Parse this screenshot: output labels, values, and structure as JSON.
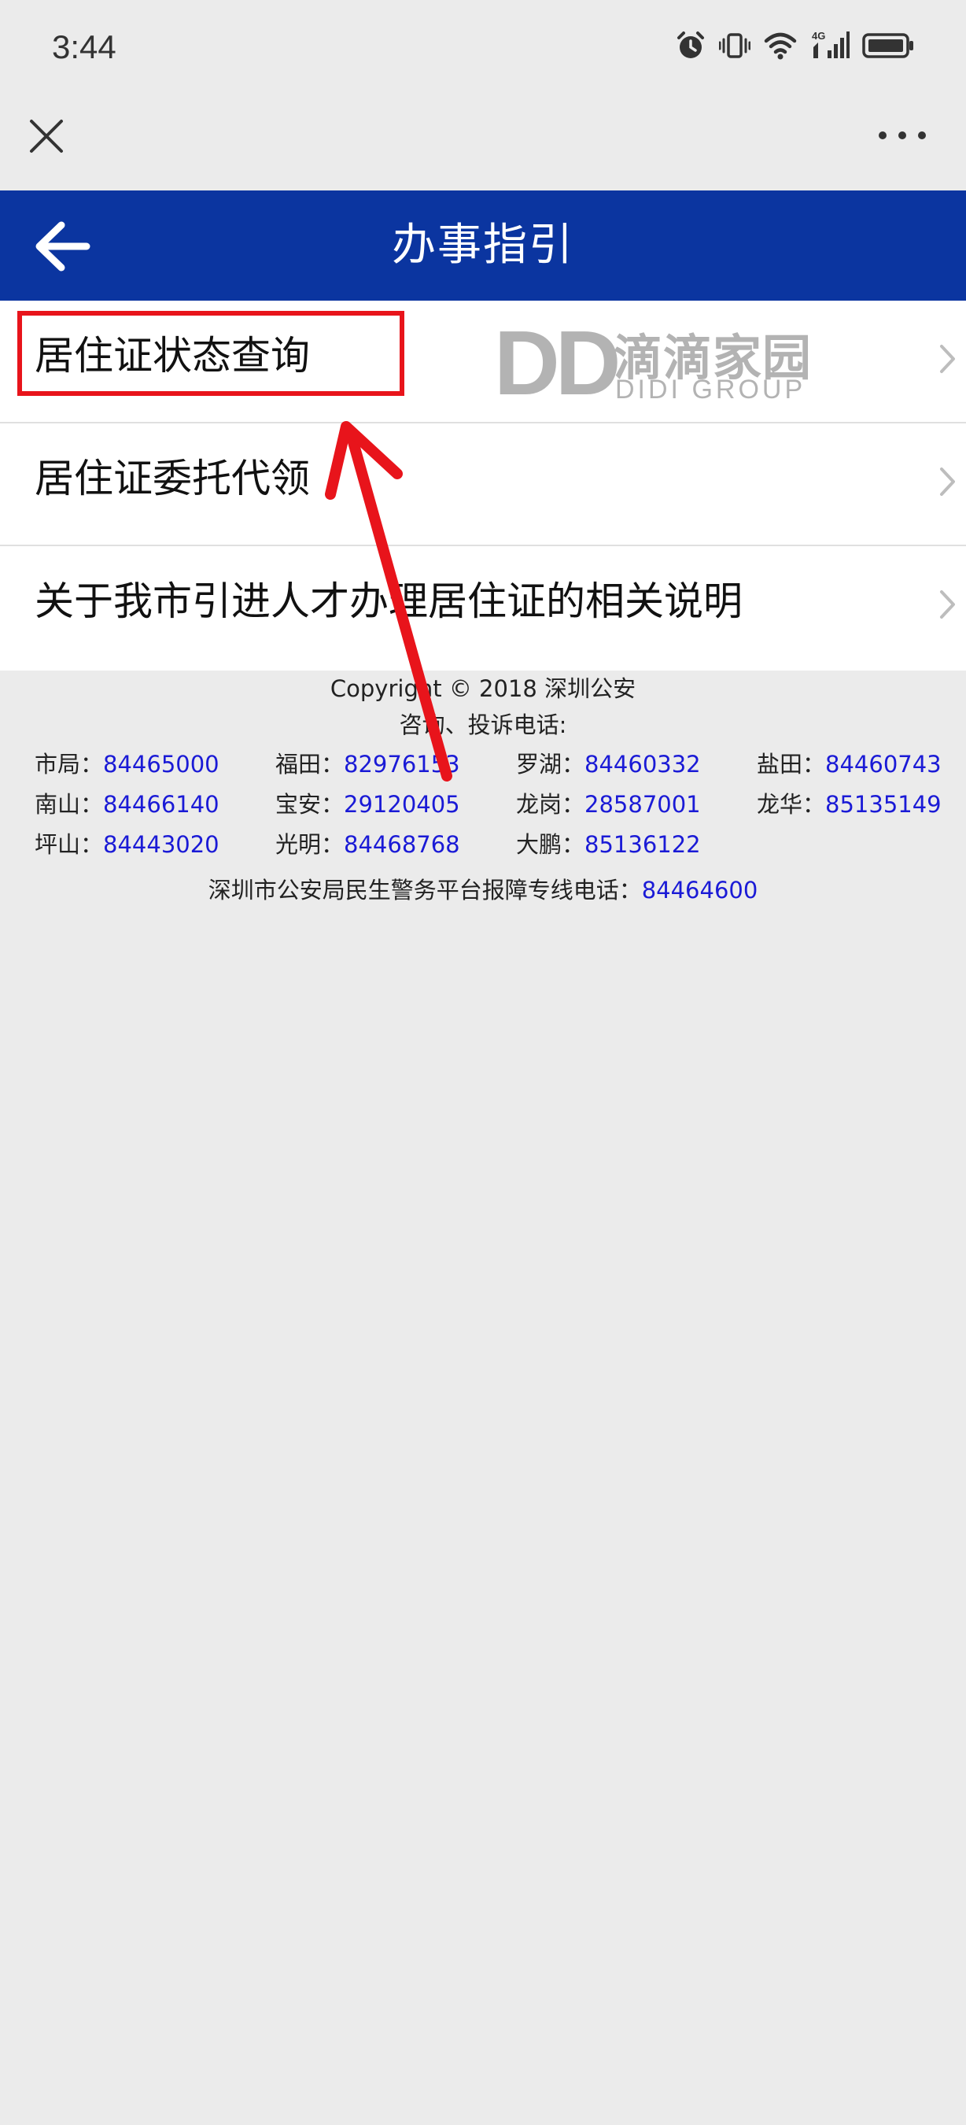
{
  "status_bar": {
    "time": "3:44",
    "network": "4G",
    "icons": [
      "alarm-icon",
      "vibrate-icon",
      "wifi-icon",
      "signal-icon",
      "battery-icon"
    ]
  },
  "webview_bar": {
    "close_icon": "close-icon",
    "more_icon": "more-icon"
  },
  "header": {
    "title": "办事指引",
    "back_icon": "back-arrow-icon",
    "background_color": "#0b35a0"
  },
  "menu": {
    "items": [
      {
        "label": "居住证状态查询"
      },
      {
        "label": "居住证委托代领"
      },
      {
        "label": "关于我市引进人才办理居住证的相关说明"
      }
    ]
  },
  "watermark": {
    "logo": "DD",
    "name_cn": "滴滴家园",
    "name_en": "DIDI GROUP"
  },
  "annotation": {
    "highlight_color": "#e8141b"
  },
  "footer": {
    "copyright": "Copyright © 2018 深圳公安",
    "hotline_title": "咨询、投诉电话:",
    "hotlines": [
      {
        "label": "市局：",
        "number": "84465000"
      },
      {
        "label": "福田：",
        "number": "82976153"
      },
      {
        "label": "罗湖：",
        "number": "84460332"
      },
      {
        "label": "盐田：",
        "number": "84460743"
      },
      {
        "label": "南山：",
        "number": "84466140"
      },
      {
        "label": "宝安：",
        "number": "29120405"
      },
      {
        "label": "龙岗：",
        "number": "28587001"
      },
      {
        "label": "龙华：",
        "number": "85135149"
      },
      {
        "label": "坪山：",
        "number": "84443020"
      },
      {
        "label": "光明：",
        "number": "84468768"
      },
      {
        "label": "大鹏：",
        "number": "85136122"
      }
    ],
    "platform_label": "深圳市公安局民生警务平台报障专线电话：",
    "platform_number": "84464600",
    "link_color": "#1a1ad6"
  }
}
